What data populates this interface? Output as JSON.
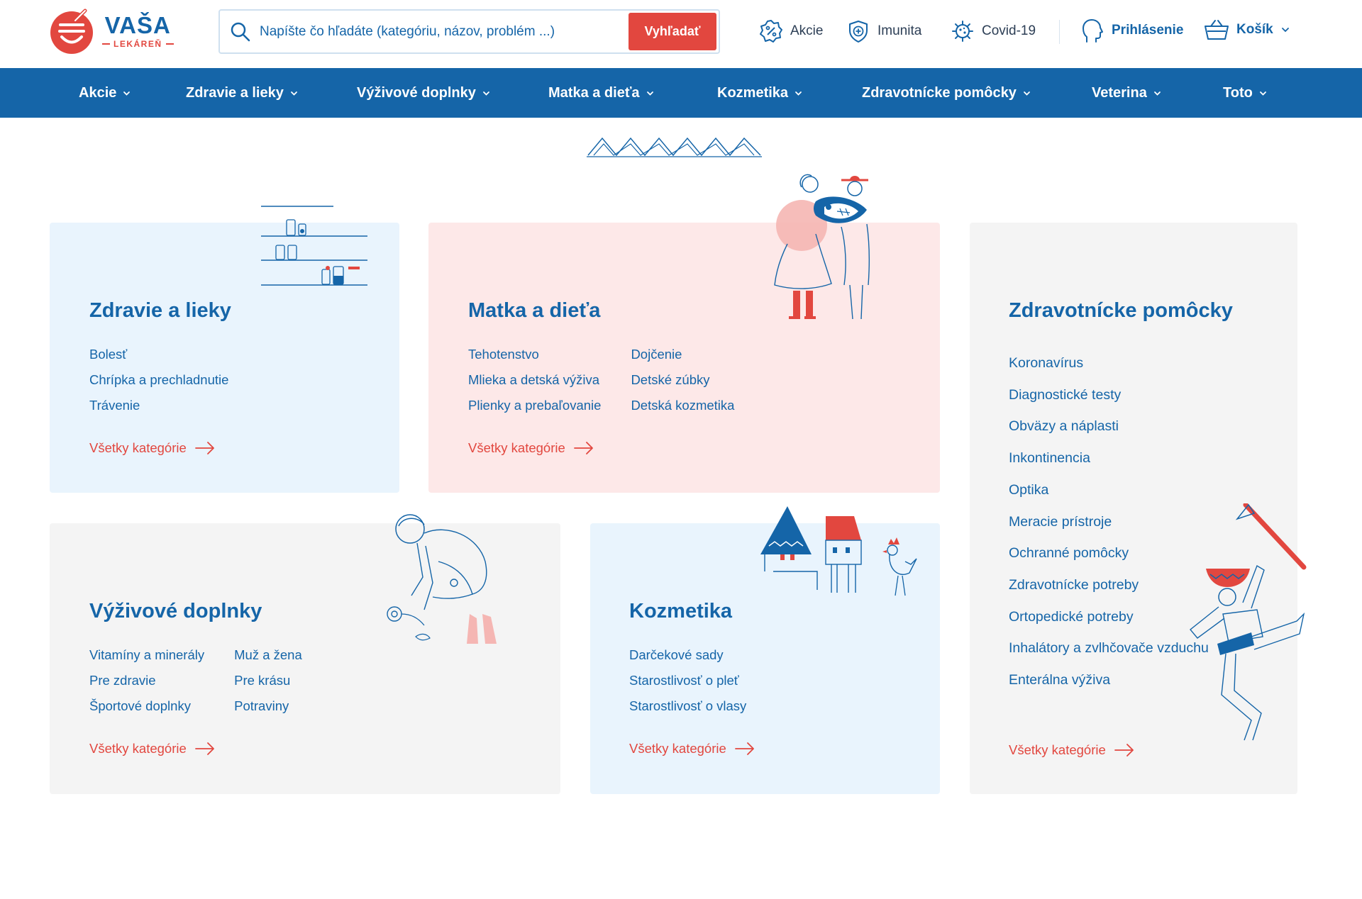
{
  "header": {
    "logo": {
      "title": "VAŠA",
      "subtitle": "LEKÁREŇ"
    },
    "search": {
      "placeholder": "Napíšte čo hľadáte (kategóriu, názov, problém ...)",
      "button_label": "Vyhľadať"
    },
    "quick_links": [
      {
        "label": "Akcie",
        "icon": "percent-badge-icon"
      },
      {
        "label": "Imunita",
        "icon": "shield-plus-icon"
      },
      {
        "label": "Covid-19",
        "icon": "virus-icon"
      }
    ],
    "login_label": "Prihlásenie",
    "cart_label": "Košík"
  },
  "nav": {
    "items": [
      "Akcie",
      "Zdravie a lieky",
      "Výživové doplnky",
      "Matka a dieťa",
      "Kozmetika",
      "Zdravotnícke pomôcky",
      "Veterina",
      "Toto"
    ]
  },
  "cards": {
    "zdravie": {
      "title": "Zdravie a lieky",
      "links": [
        "Bolesť",
        "Chrípka a prechladnutie",
        "Trávenie"
      ],
      "all_label": "Všetky kategórie"
    },
    "matka": {
      "title": "Matka a dieťa",
      "links_col1": [
        "Tehotenstvo",
        "Mlieka a detská výživa",
        "Plienky a prebaľovanie"
      ],
      "links_col2": [
        "Dojčenie",
        "Detské zúbky",
        "Detská kozmetika"
      ],
      "all_label": "Všetky kategórie"
    },
    "pomocky": {
      "title": "Zdravotnícke pomôcky",
      "links": [
        "Koronavírus",
        "Diagnostické testy",
        "Obväzy a náplasti",
        "Inkontinencia",
        "Optika",
        "Meracie prístroje",
        "Ochranné pomôcky",
        "Zdravotnícke potreby",
        "Ortopedické potreby",
        "Inhalátory a zvlhčovače vzduchu",
        "Enterálna výživa"
      ],
      "all_label": "Všetky kategórie"
    },
    "doplnky": {
      "title": "Výživové doplnky",
      "links_col1": [
        "Vitamíny a minerály",
        "Pre zdravie",
        "Športové doplnky"
      ],
      "links_col2": [
        "Muž a žena",
        "Pre krásu",
        "Potraviny"
      ],
      "all_label": "Všetky kategórie"
    },
    "kozmetika": {
      "title": "Kozmetika",
      "links": [
        "Darčekové sady",
        "Starostlivosť o pleť",
        "Starostlivosť o vlasy"
      ],
      "all_label": "Všetky kategórie"
    }
  },
  "colors": {
    "primary_blue": "#1565a8",
    "accent_red": "#e2473f",
    "card_light_blue": "#e9f4fd",
    "card_pink": "#fde8e8",
    "card_gray": "#f4f4f4"
  }
}
